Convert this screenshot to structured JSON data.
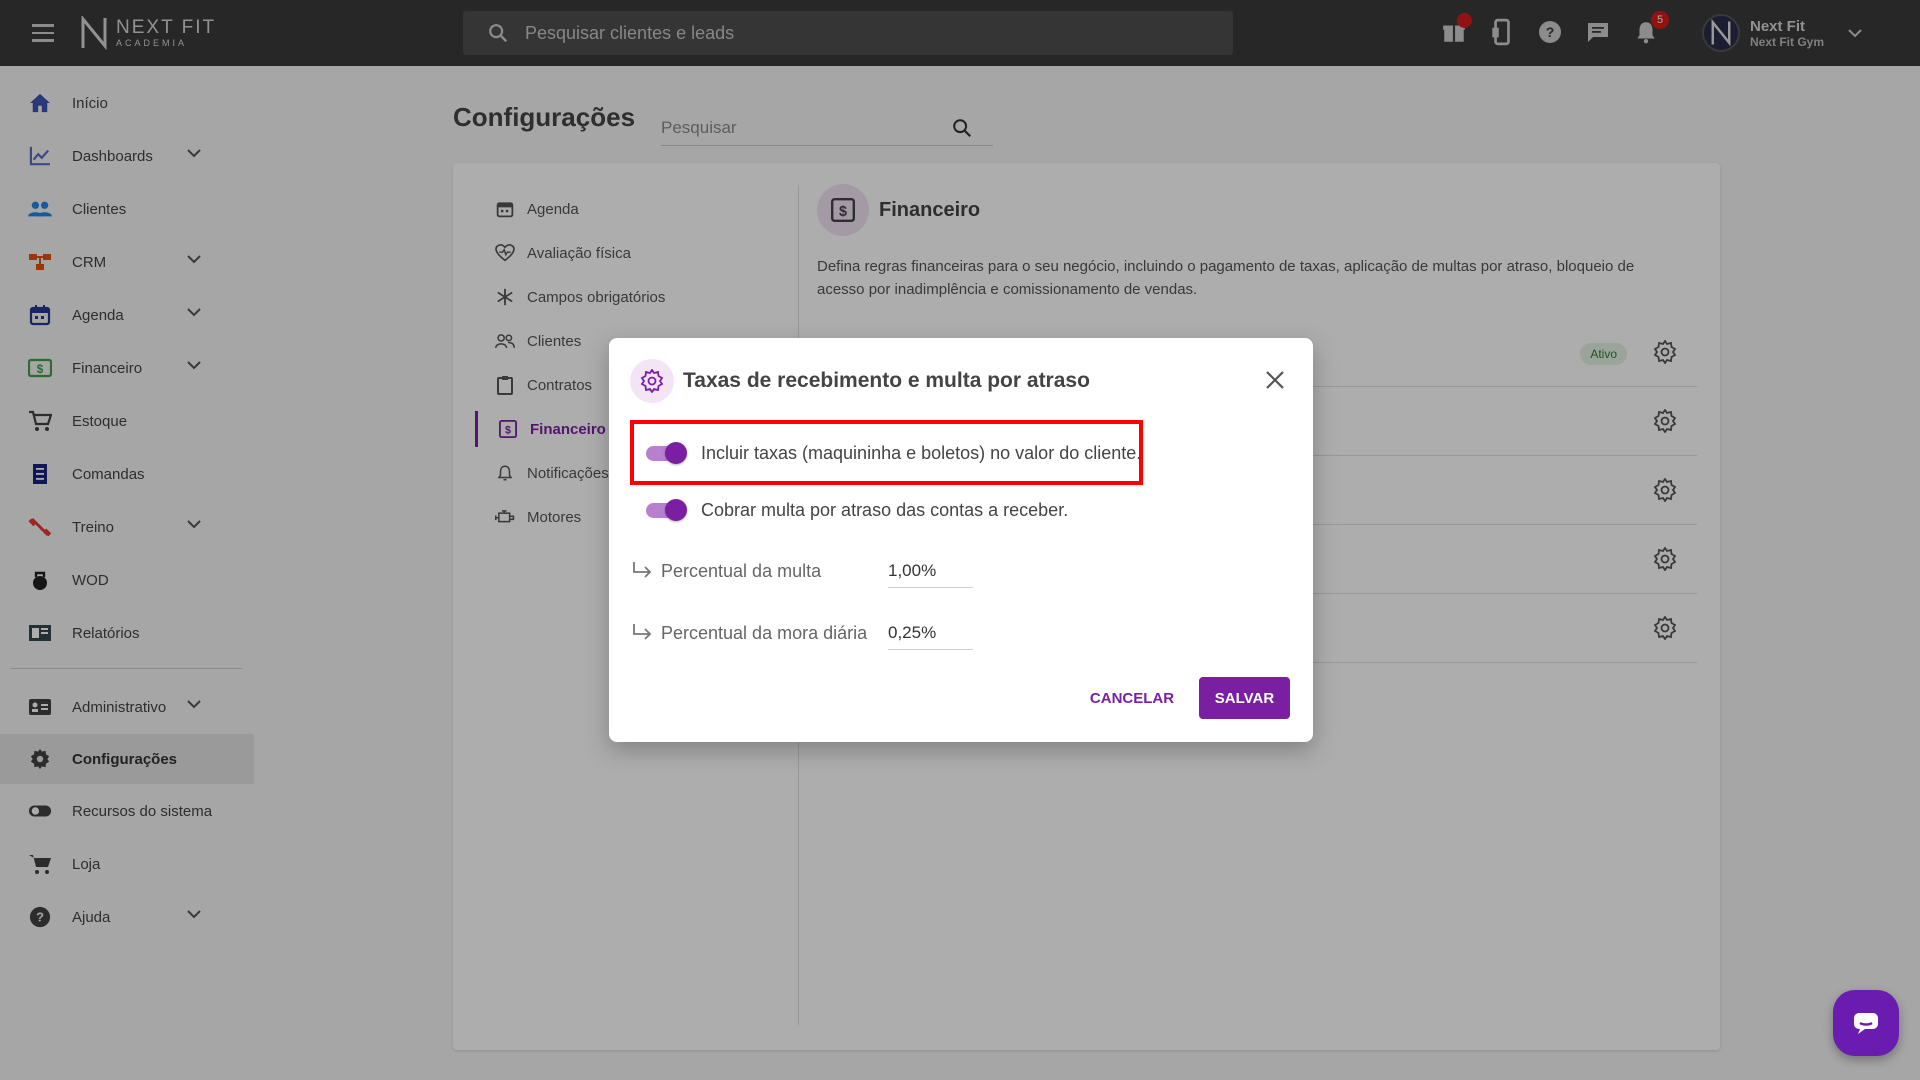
{
  "header": {
    "logo_line1": "NEXT FIT",
    "logo_line2": "ACADEMIA",
    "search_placeholder": "Pesquisar clientes e leads",
    "notifications_count": "5",
    "user_name": "Next Fit",
    "user_gym": "Next Fit Gym",
    "icons": [
      "gift-icon",
      "mobile-phone-icon",
      "help-icon",
      "chat-icon",
      "bell-icon"
    ]
  },
  "sidebar": {
    "items": [
      {
        "label": "Início",
        "icon": "home-icon",
        "color": "#3f51b5"
      },
      {
        "label": "Dashboards",
        "icon": "chart-line-icon",
        "color": "#5c6bc0"
      },
      {
        "label": "Clientes",
        "icon": "people-icon",
        "color": "#1e88e5"
      },
      {
        "label": "CRM",
        "icon": "crm-icon",
        "color": "#e65100"
      },
      {
        "label": "Agenda",
        "icon": "calendar-icon",
        "color": "#283593"
      },
      {
        "label": "Financeiro",
        "icon": "money-icon",
        "color": "#43a047"
      },
      {
        "label": "Estoque",
        "icon": "cart-icon",
        "color": "#424242"
      },
      {
        "label": "Comandas",
        "icon": "receipt-icon",
        "color": "#1a237e"
      },
      {
        "label": "Treino",
        "icon": "dumbbell-icon",
        "color": "#e53935"
      },
      {
        "label": "WOD",
        "icon": "kettlebell-icon",
        "color": "#212121"
      },
      {
        "label": "Relatórios",
        "icon": "report-icon",
        "color": "#37474f"
      },
      {
        "label": "Administrativo",
        "icon": "admin-card-icon",
        "color": "#424242"
      },
      {
        "label": "Configurações",
        "icon": "gear-icon",
        "color": "#424242"
      },
      {
        "label": "Recursos do sistema",
        "icon": "toggle-icon",
        "color": "#424242"
      },
      {
        "label": "Loja",
        "icon": "shop-cart-icon",
        "color": "#424242"
      },
      {
        "label": "Ajuda",
        "icon": "help-circle-icon",
        "color": "#424242"
      }
    ]
  },
  "page": {
    "title": "Configurações",
    "search_placeholder": "Pesquisar"
  },
  "settings_nav": {
    "items": [
      {
        "label": "Agenda",
        "icon": "calendar-icon"
      },
      {
        "label": "Avaliação física",
        "icon": "heart-pulse-icon"
      },
      {
        "label": "Campos obrigatórios",
        "icon": "asterisk-icon"
      },
      {
        "label": "Clientes",
        "icon": "people-outline-icon"
      },
      {
        "label": "Contratos",
        "icon": "clipboard-icon"
      },
      {
        "label": "Financeiro",
        "icon": "money-icon"
      },
      {
        "label": "Notificações",
        "icon": "bell-outline-icon"
      },
      {
        "label": "Motores",
        "icon": "engine-icon"
      }
    ]
  },
  "financeiro": {
    "title": "Financeiro",
    "description": "Defina regras financeiras para o seu negócio, incluindo o pagamento de taxas, aplicação de multas por atraso, bloqueio de acesso por inadimplência e comissionamento de vendas.",
    "ativo_label": "Ativo"
  },
  "dialog": {
    "title": "Taxas de recebimento e multa por atraso",
    "toggle1_label": "Incluir taxas (maquininha e boletos) no valor do cliente.",
    "toggle2_label": "Cobrar multa por atraso das contas a receber.",
    "field1_label": "Percentual da multa",
    "field1_value": "1,00%",
    "field2_label": "Percentual da mora diária",
    "field2_value": "0,25%",
    "cancel_label": "CANCELAR",
    "save_label": "SALVAR"
  },
  "colors": {
    "accent": "#7b1fa2",
    "highlight": "#ff0000",
    "topbar": "#3a3a3a"
  }
}
